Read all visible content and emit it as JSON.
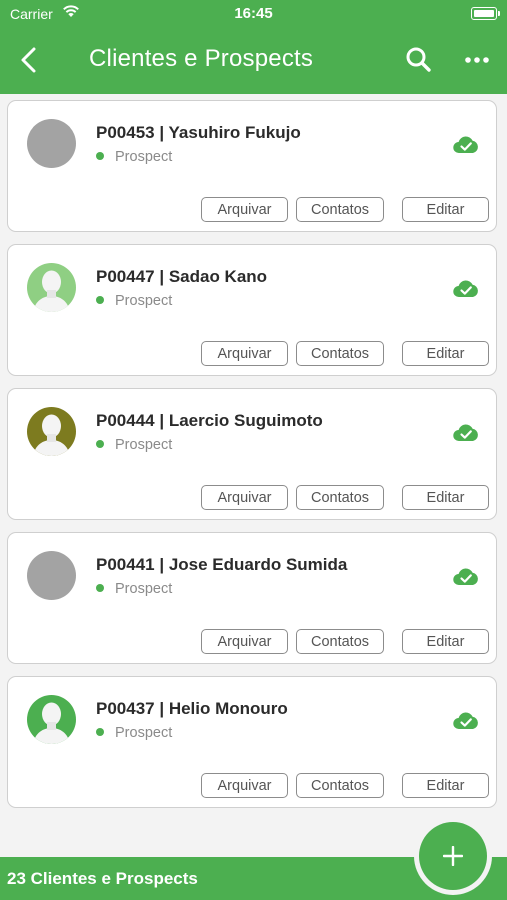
{
  "status_bar": {
    "carrier": "Carrier",
    "time": "16:45"
  },
  "nav": {
    "title": "Clientes e Prospects",
    "back_icon": "chevron-left-icon",
    "search_icon": "search-icon",
    "more_icon": "more-dots-icon"
  },
  "colors": {
    "primary": "#4caf50",
    "background": "#f3f3f3",
    "avatar_gray": "#a3a3a3",
    "avatar_light_green": "#8fcf83",
    "avatar_olive": "#7d7b1f"
  },
  "cards": [
    {
      "name": "P00453 | Yasuhiro Fukujo",
      "status": "Prospect",
      "avatar": "placeholder",
      "archive_label": "Arquivar",
      "contacts_label": "Contatos",
      "edit_label": "Editar",
      "sync_icon": "cloud-check-icon"
    },
    {
      "name": "P00447 | Sadao Kano",
      "status": "Prospect",
      "avatar": "person-light-green",
      "archive_label": "Arquivar",
      "contacts_label": "Contatos",
      "edit_label": "Editar",
      "sync_icon": "cloud-check-icon"
    },
    {
      "name": "P00444 | Laercio Suguimoto",
      "status": "Prospect",
      "avatar": "person-olive",
      "archive_label": "Arquivar",
      "contacts_label": "Contatos",
      "edit_label": "Editar",
      "sync_icon": "cloud-check-icon"
    },
    {
      "name": "P00441 | Jose Eduardo Sumida",
      "status": "Prospect",
      "avatar": "placeholder",
      "archive_label": "Arquivar",
      "contacts_label": "Contatos",
      "edit_label": "Editar",
      "sync_icon": "cloud-check-icon"
    },
    {
      "name": "P00437 | Helio Monouro",
      "status": "Prospect",
      "avatar": "person-green",
      "archive_label": "Arquivar",
      "contacts_label": "Contatos",
      "edit_label": "Editar",
      "sync_icon": "cloud-check-icon"
    }
  ],
  "footer": {
    "count_label": "23 Clientes e Prospects",
    "add_icon": "plus-icon"
  }
}
